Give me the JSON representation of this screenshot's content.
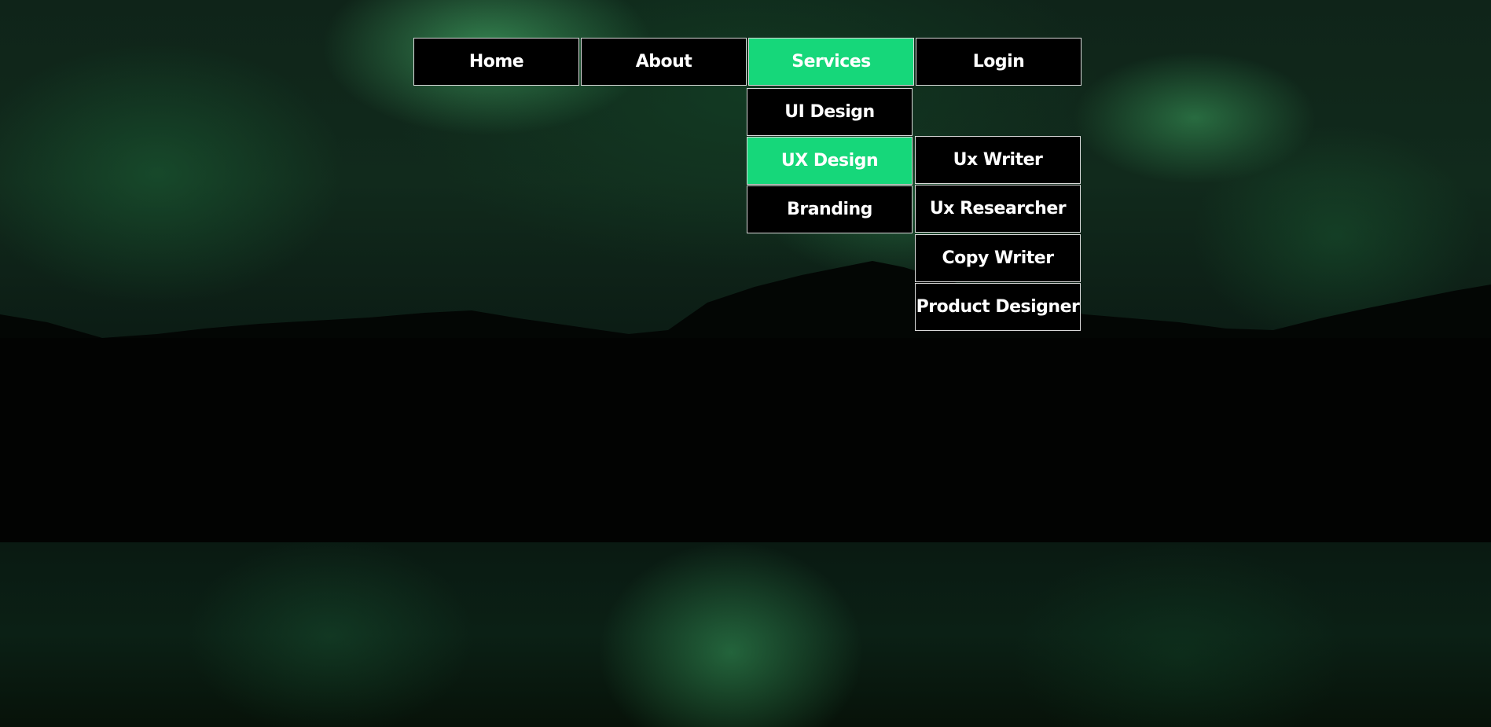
{
  "nav": {
    "items": [
      {
        "label": "Home"
      },
      {
        "label": "About"
      },
      {
        "label": "Services",
        "active": true
      },
      {
        "label": "Login"
      }
    ]
  },
  "services_menu": {
    "items": [
      {
        "label": "UI Design"
      },
      {
        "label": "UX Design",
        "active": true
      },
      {
        "label": "Branding"
      }
    ]
  },
  "ux_submenu": {
    "items": [
      {
        "label": "Ux Writer"
      },
      {
        "label": "Ux Researcher"
      },
      {
        "label": "Copy Writer"
      },
      {
        "label": "Product Designer"
      }
    ]
  },
  "colors": {
    "accent": "#16d77a",
    "item_background": "#000000",
    "item_border": "#d9d9d9",
    "text": "#ffffff"
  },
  "background": {
    "subject": "aurora-night-sky-over-mountains"
  }
}
